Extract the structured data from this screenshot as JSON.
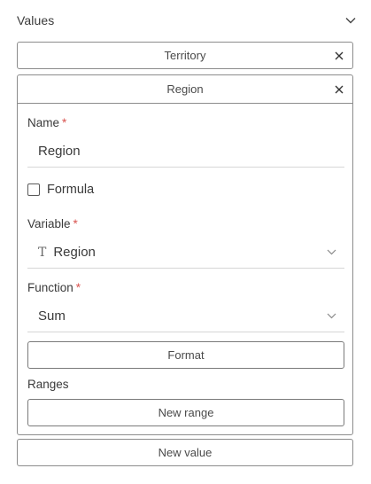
{
  "header": {
    "title": "Values"
  },
  "items": [
    {
      "label": "Territory",
      "collapsed": true
    },
    {
      "label": "Region",
      "collapsed": false
    }
  ],
  "form": {
    "name_label": "Name",
    "name_value": "Region",
    "formula_label": "Formula",
    "formula_checked": false,
    "variable_label": "Variable",
    "variable_type_icon": "T",
    "variable_value": "Region",
    "function_label": "Function",
    "function_value": "Sum",
    "format_button": "Format",
    "ranges_label": "Ranges",
    "new_range_button": "New range",
    "required_mark": "*"
  },
  "footer": {
    "new_value_button": "New value"
  },
  "colors": {
    "border": "#8c8c8c",
    "required": "#d9534f",
    "text": "#3a3a3a"
  },
  "icons": {
    "collapse": "chevron-down-icon",
    "remove": "close-icon",
    "type": "text-type-icon"
  }
}
